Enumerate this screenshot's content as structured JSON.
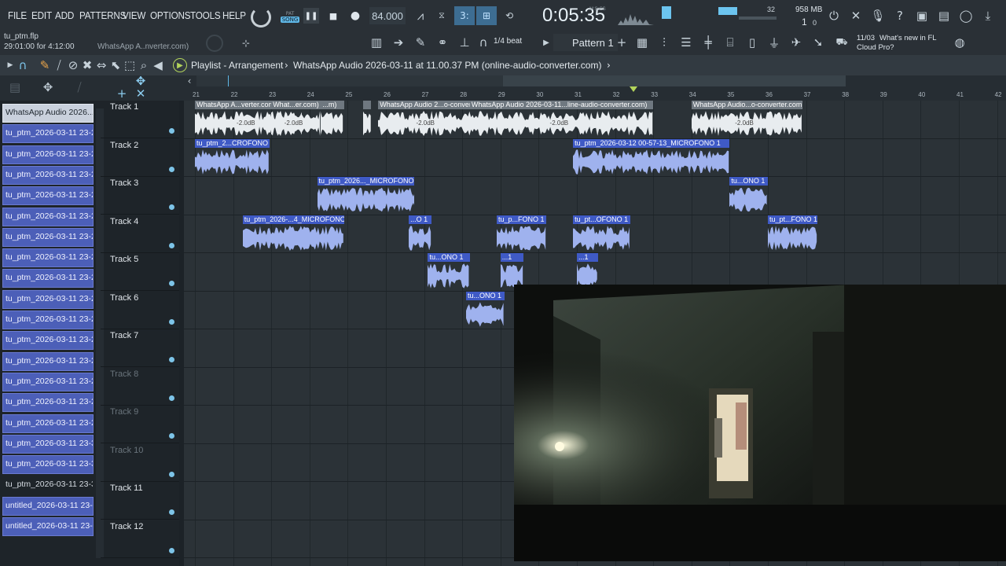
{
  "menu": [
    "FILE",
    "EDIT",
    "ADD",
    "PATTERNS",
    "VIEW",
    "OPTIONS",
    "TOOLS",
    "HELP"
  ],
  "transport": {
    "mode_top": "PAT",
    "mode_bottom": "SONG",
    "tempo": "84.000",
    "time": "0:05:35",
    "time_unit": "M:S:CS",
    "steps": "32",
    "ram": "958 MB",
    "cpu": "1",
    "cpu_extra": "0"
  },
  "project": {
    "file": "tu_ptm.flp",
    "position": "29:01:00 for 4:12:00",
    "hint": "WhatsApp A..nverter.com)"
  },
  "snap": "1/4 beat",
  "pattern": "Pattern 1",
  "news": {
    "date": "11/03",
    "text1": "What's new in FL",
    "text2": "Cloud Pro?"
  },
  "playlist": {
    "title": "Playlist - Arrangement",
    "clip": "WhatsApp Audio 2026-03-11 at 11.00.37 PM (online-audio-converter.com)"
  },
  "ruler": [
    "21",
    "22",
    "23",
    "24",
    "25",
    "26",
    "27",
    "28",
    "29",
    "30",
    "31",
    "32",
    "33",
    "34",
    "35",
    "36",
    "37",
    "38",
    "39",
    "40",
    "41",
    "42"
  ],
  "picker": [
    "WhatsApp Audio 2026...",
    "tu_ptm_2026-03-11 23-2...",
    "tu_ptm_2026-03-11 23-2...",
    "tu_ptm_2026-03-11 23-2...",
    "tu_ptm_2026-03-11 23-2...",
    "tu_ptm_2026-03-11 23-2...",
    "tu_ptm_2026-03-11 23-2...",
    "tu_ptm_2026-03-11 23-2...",
    "tu_ptm_2026-03-11 23-2...",
    "tu_ptm_2026-03-11 23-2...",
    "tu_ptm_2026-03-11 23-2...",
    "tu_ptm_2026-03-11 23-2...",
    "tu_ptm_2026-03-11 23-2...",
    "tu_ptm_2026-03-11 23-2...",
    "tu_ptm_2026-03-11 23-2...",
    "tu_ptm_2026-03-11 23-2...",
    "tu_ptm_2026-03-11 23-3...",
    "tu_ptm_2026-03-11 23-3...",
    "tu_ptm_2026-03-11 23-3...",
    "untitled_2026-03-11 23-...",
    "untitled_2026-03-11 23-..."
  ],
  "tracks": [
    "Track 1",
    "Track 2",
    "Track 3",
    "Track 4",
    "Track 5",
    "Track 6",
    "Track 7",
    "Track 8",
    "Track 9",
    "Track 10",
    "Track 11",
    "Track 12"
  ],
  "clips": [
    {
      "track": 1,
      "start": 21.0,
      "end": 23.8,
      "label": "WhatsApp A...verter.com)",
      "grey": true
    },
    {
      "track": 1,
      "start": 23.0,
      "end": 24.3,
      "label": "What...er.com)",
      "grey": true
    },
    {
      "track": 1,
      "start": 24.3,
      "end": 24.9,
      "label": "...m)",
      "grey": true
    },
    {
      "track": 1,
      "start": 25.4,
      "end": 25.6,
      "label": "",
      "grey": true
    },
    {
      "track": 1,
      "start": 25.8,
      "end": 28.4,
      "label": "WhatsApp Audio 2...o-converter.com)",
      "grey": true
    },
    {
      "track": 1,
      "start": 28.2,
      "end": 33.0,
      "label": "WhatsApp Audio 2026-03-11...line-audio-converter.com)",
      "grey": true
    },
    {
      "track": 1,
      "start": 34.0,
      "end": 36.9,
      "label": "WhatsApp Audio...o-converter.com)",
      "grey": true
    },
    {
      "track": 2,
      "start": 21.0,
      "end": 22.95,
      "label": "tu_ptm_2...CROFONO 1",
      "grey": false
    },
    {
      "track": 2,
      "start": 30.9,
      "end": 35.0,
      "label": "tu_ptm_2026-03-12 00-57-13_MICROFONO 1",
      "grey": false
    },
    {
      "track": 3,
      "start": 24.2,
      "end": 26.75,
      "label": "tu_ptm_2026..._MICROFONO 1",
      "grey": false
    },
    {
      "track": 3,
      "start": 35.0,
      "end": 36.0,
      "label": "tu...ONO 1",
      "grey": false
    },
    {
      "track": 4,
      "start": 22.25,
      "end": 24.9,
      "label": "tu_ptm_2026-...4_MICROFONO 1",
      "grey": false
    },
    {
      "track": 4,
      "start": 26.6,
      "end": 27.2,
      "label": "...O 1",
      "grey": false
    },
    {
      "track": 4,
      "start": 28.9,
      "end": 30.2,
      "label": "tu_p...FONO 1",
      "grey": false
    },
    {
      "track": 4,
      "start": 30.9,
      "end": 32.4,
      "label": "tu_pt...OFONO 1",
      "grey": false
    },
    {
      "track": 4,
      "start": 36.0,
      "end": 37.3,
      "label": "tu_pt...FONO 1",
      "grey": false
    },
    {
      "track": 5,
      "start": 27.1,
      "end": 28.2,
      "label": "tu...ONO 1",
      "grey": false
    },
    {
      "track": 5,
      "start": 29.0,
      "end": 29.6,
      "label": "...1",
      "grey": false
    },
    {
      "track": 5,
      "start": 31.0,
      "end": 31.55,
      "label": "...1",
      "grey": false
    },
    {
      "track": 6,
      "start": 28.1,
      "end": 29.1,
      "label": "tu...ONO 1",
      "grey": false
    }
  ],
  "gain_label": "-2.0dB",
  "colors": {
    "clip_blue": "#3f5ac6",
    "wave": "#9fb2ee",
    "grey_wave": "#e8ecef",
    "accent": "#5fb7e6",
    "lcd": "#9fd8ff"
  }
}
